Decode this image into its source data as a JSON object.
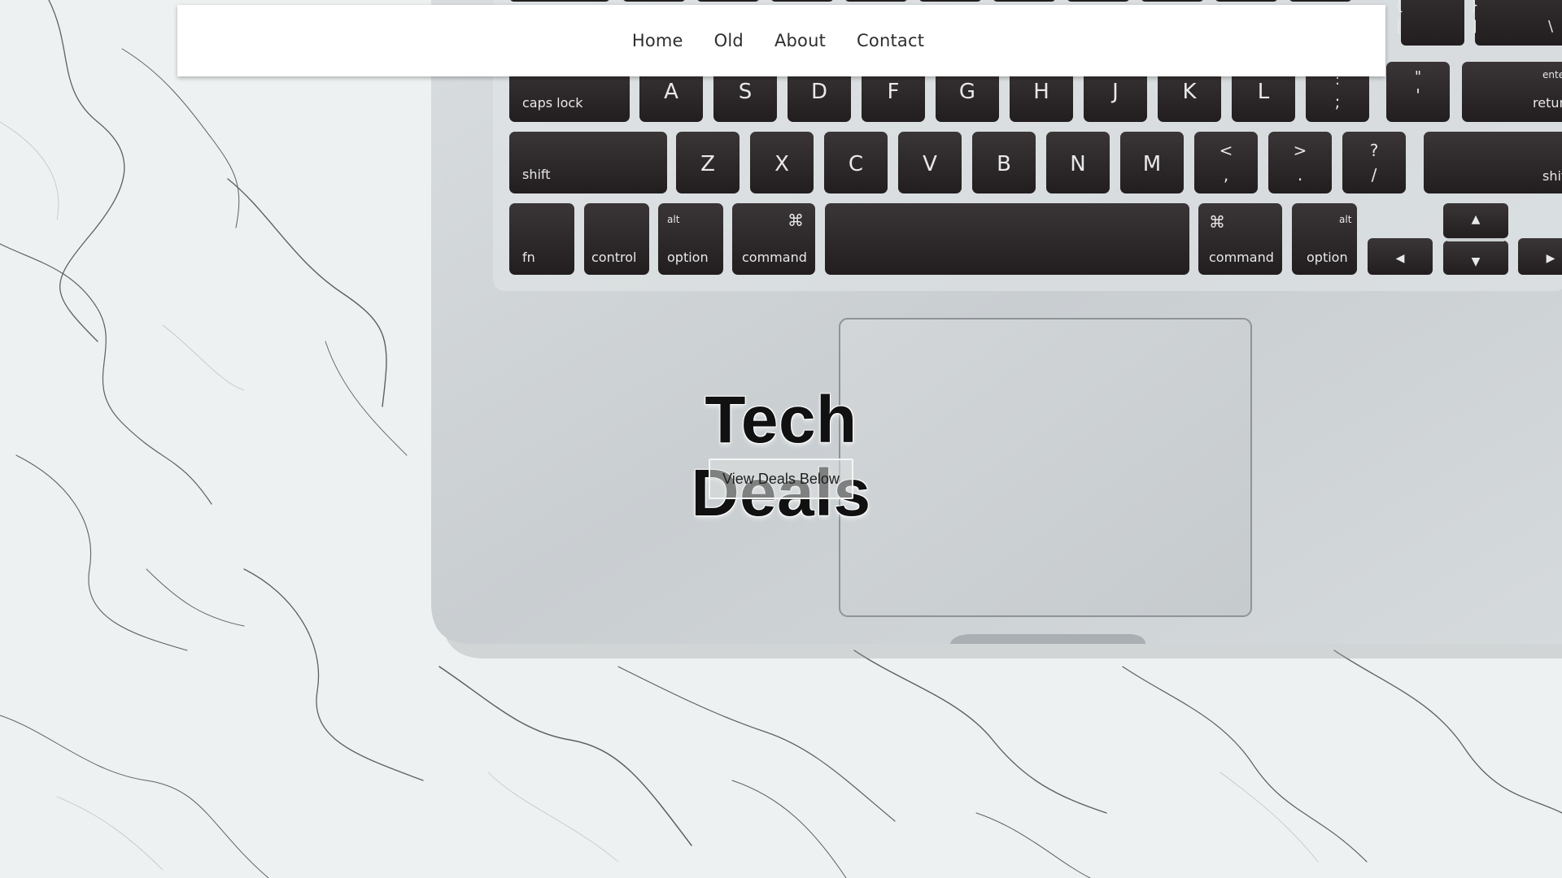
{
  "nav": {
    "items": [
      {
        "label": "Home"
      },
      {
        "label": "Old"
      },
      {
        "label": "About"
      },
      {
        "label": "Contact"
      }
    ]
  },
  "hero": {
    "title": "Tech Deals",
    "button_label": "View Deals Below"
  },
  "keyboard": {
    "number_row_keys": [
      "{",
      "[",
      "}",
      "]",
      "\\"
    ],
    "row_asdf": [
      "caps lock",
      "A",
      "S",
      "D",
      "F",
      "G",
      "H",
      "J",
      "K",
      "L",
      ":",
      ";",
      "\"",
      "'",
      "enter",
      "return"
    ],
    "row_zxcv": [
      "shift",
      "Z",
      "X",
      "C",
      "V",
      "B",
      "N",
      "M",
      "<",
      ",",
      ">",
      ".",
      "?",
      "/",
      "shift"
    ],
    "row_bottom": [
      "fn",
      "control",
      "alt",
      "option",
      "⌘",
      "command",
      "⌘",
      "command",
      "alt",
      "option",
      "◀",
      "▲",
      "▼",
      "▶"
    ]
  },
  "colors": {
    "navbar_bg": "#ffffff",
    "nav_text": "#2e2e2e",
    "title_text": "#111111",
    "key_fill": "#2a2627",
    "laptop_body": "#cfd4d6",
    "marble": "#eef1f1"
  }
}
